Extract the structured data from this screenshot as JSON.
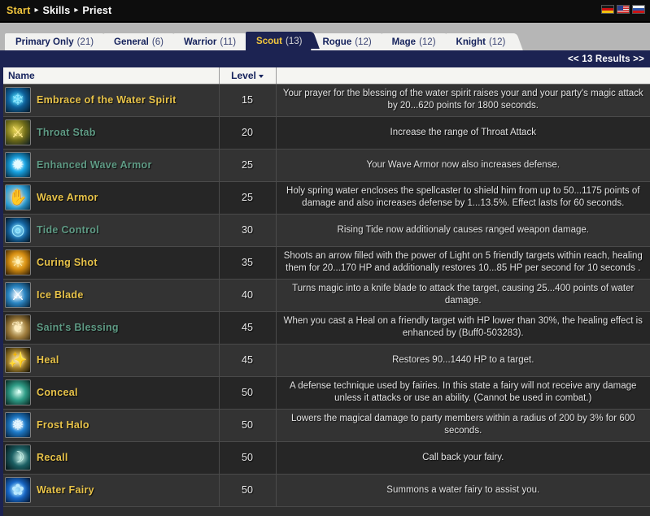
{
  "breadcrumb": {
    "items": [
      "Start",
      "Skills",
      "Priest"
    ],
    "separator": "▸"
  },
  "languages": [
    {
      "name": "german-flag",
      "label": "Deutsch"
    },
    {
      "name": "us-flag",
      "label": "English"
    },
    {
      "name": "russian-flag",
      "label": "Русский"
    }
  ],
  "tabs": [
    {
      "label": "Primary Only",
      "count": "(21)",
      "active": false
    },
    {
      "label": "General",
      "count": "(6)",
      "active": false
    },
    {
      "label": "Warrior",
      "count": "(11)",
      "active": false
    },
    {
      "label": "Scout",
      "count": "(13)",
      "active": true
    },
    {
      "label": "Rogue",
      "count": "(12)",
      "active": false
    },
    {
      "label": "Mage",
      "count": "(12)",
      "active": false
    },
    {
      "label": "Knight",
      "count": "(12)",
      "active": false
    }
  ],
  "results": {
    "text": "<< 13 Results >>",
    "prev_label": "<<",
    "count": "13 Results",
    "next_label": ">>"
  },
  "columns": {
    "name": "Name",
    "level": "Level",
    "description": ""
  },
  "colors": {
    "accent_gold": "#e8c349",
    "accent_navy": "#1c2352",
    "name_teal": "#5f9b85",
    "row_odd": "#333333",
    "row_even": "#262626"
  },
  "rows": [
    {
      "icon": "ic-spirit",
      "icon_name": "skill-icon-embrace-of-the-water-spirit",
      "glyph": "❄",
      "glyph_color": "#8fe8ff",
      "name": "Embrace of the Water Spirit",
      "name_color": "gold",
      "level": "15",
      "description": "Your prayer for the blessing of the water spirit raises your and your party's magic attack by 20...620 points for 1800 seconds."
    },
    {
      "icon": "ic-throat",
      "icon_name": "skill-icon-throat-stab",
      "glyph": "⚔",
      "glyph_color": "#ffe98a",
      "name": "Throat Stab",
      "name_color": "teal",
      "level": "20",
      "description": "Increase the range of Throat Attack"
    },
    {
      "icon": "ic-ewave",
      "icon_name": "skill-icon-enhanced-wave-armor",
      "glyph": "✹",
      "glyph_color": "#e6fbff",
      "name": "Enhanced Wave Armor",
      "name_color": "teal",
      "level": "25",
      "description": "Your Wave Armor now also increases defense."
    },
    {
      "icon": "ic-wave",
      "icon_name": "skill-icon-wave-armor",
      "glyph": "✋",
      "glyph_color": "#ffe6c2",
      "name": "Wave Armor",
      "name_color": "gold",
      "level": "25",
      "description": "Holy spring water encloses the spellcaster to shield him from up to 50...1175 points of damage and also increases defense by 1...13.5%. Effect lasts for 60 seconds."
    },
    {
      "icon": "ic-tide",
      "icon_name": "skill-icon-tide-control",
      "glyph": "◎",
      "glyph_color": "#9fe9ff",
      "name": "Tide Control",
      "name_color": "teal",
      "level": "30",
      "description": "Rising Tide now additionaly causes ranged weapon damage."
    },
    {
      "icon": "ic-curing",
      "icon_name": "skill-icon-curing-shot",
      "glyph": "☀",
      "glyph_color": "#fff1b8",
      "name": "Curing Shot",
      "name_color": "gold",
      "level": "35",
      "description": "Shoots an arrow filled with the power of Light on 5 friendly targets within reach, healing them for 20...170 HP and additionally restores 10...85 HP per second for 10 seconds ."
    },
    {
      "icon": "ic-ice",
      "icon_name": "skill-icon-ice-blade",
      "glyph": "⚔",
      "glyph_color": "#ffffff",
      "name": "Ice Blade",
      "name_color": "gold",
      "level": "40",
      "description": "Turns magic into a knife blade to attack the target, causing 25...400 points of water damage."
    },
    {
      "icon": "ic-saint",
      "icon_name": "skill-icon-saints-blessing",
      "glyph": "❦",
      "glyph_color": "#ffeec0",
      "name": "Saint's Blessing",
      "name_color": "teal",
      "level": "45",
      "description": "When you cast a Heal on a friendly target with HP lower than 30%, the healing effect is enhanced by (Buff0-503283)."
    },
    {
      "icon": "ic-heal",
      "icon_name": "skill-icon-heal",
      "glyph": "✨",
      "glyph_color": "#ffeaa8",
      "name": "Heal",
      "name_color": "gold",
      "level": "45",
      "description": "Restores 90...1440 HP to a target."
    },
    {
      "icon": "ic-conceal",
      "icon_name": "skill-icon-conceal",
      "glyph": "◔",
      "glyph_color": "#d8fff3",
      "name": "Conceal",
      "name_color": "gold",
      "level": "50",
      "description": "A defense technique used by fairies. In this state a fairy will not receive any damage unless it attacks or use an ability. (Cannot be used in combat.)"
    },
    {
      "icon": "ic-frost",
      "icon_name": "skill-icon-frost-halo",
      "glyph": "❅",
      "glyph_color": "#eaf8ff",
      "name": "Frost Halo",
      "name_color": "gold",
      "level": "50",
      "description": "Lowers the magical damage to party members within a radius of 200 by 3% for 600 seconds."
    },
    {
      "icon": "ic-recall",
      "icon_name": "skill-icon-recall",
      "glyph": "☽",
      "glyph_color": "#cdf3ea",
      "name": "Recall",
      "name_color": "gold",
      "level": "50",
      "description": "Call back your fairy."
    },
    {
      "icon": "ic-fairy",
      "icon_name": "skill-icon-water-fairy",
      "glyph": "✿",
      "glyph_color": "#b9e8ff",
      "name": "Water Fairy",
      "name_color": "gold",
      "level": "50",
      "description": "Summons a water fairy to assist you."
    }
  ]
}
